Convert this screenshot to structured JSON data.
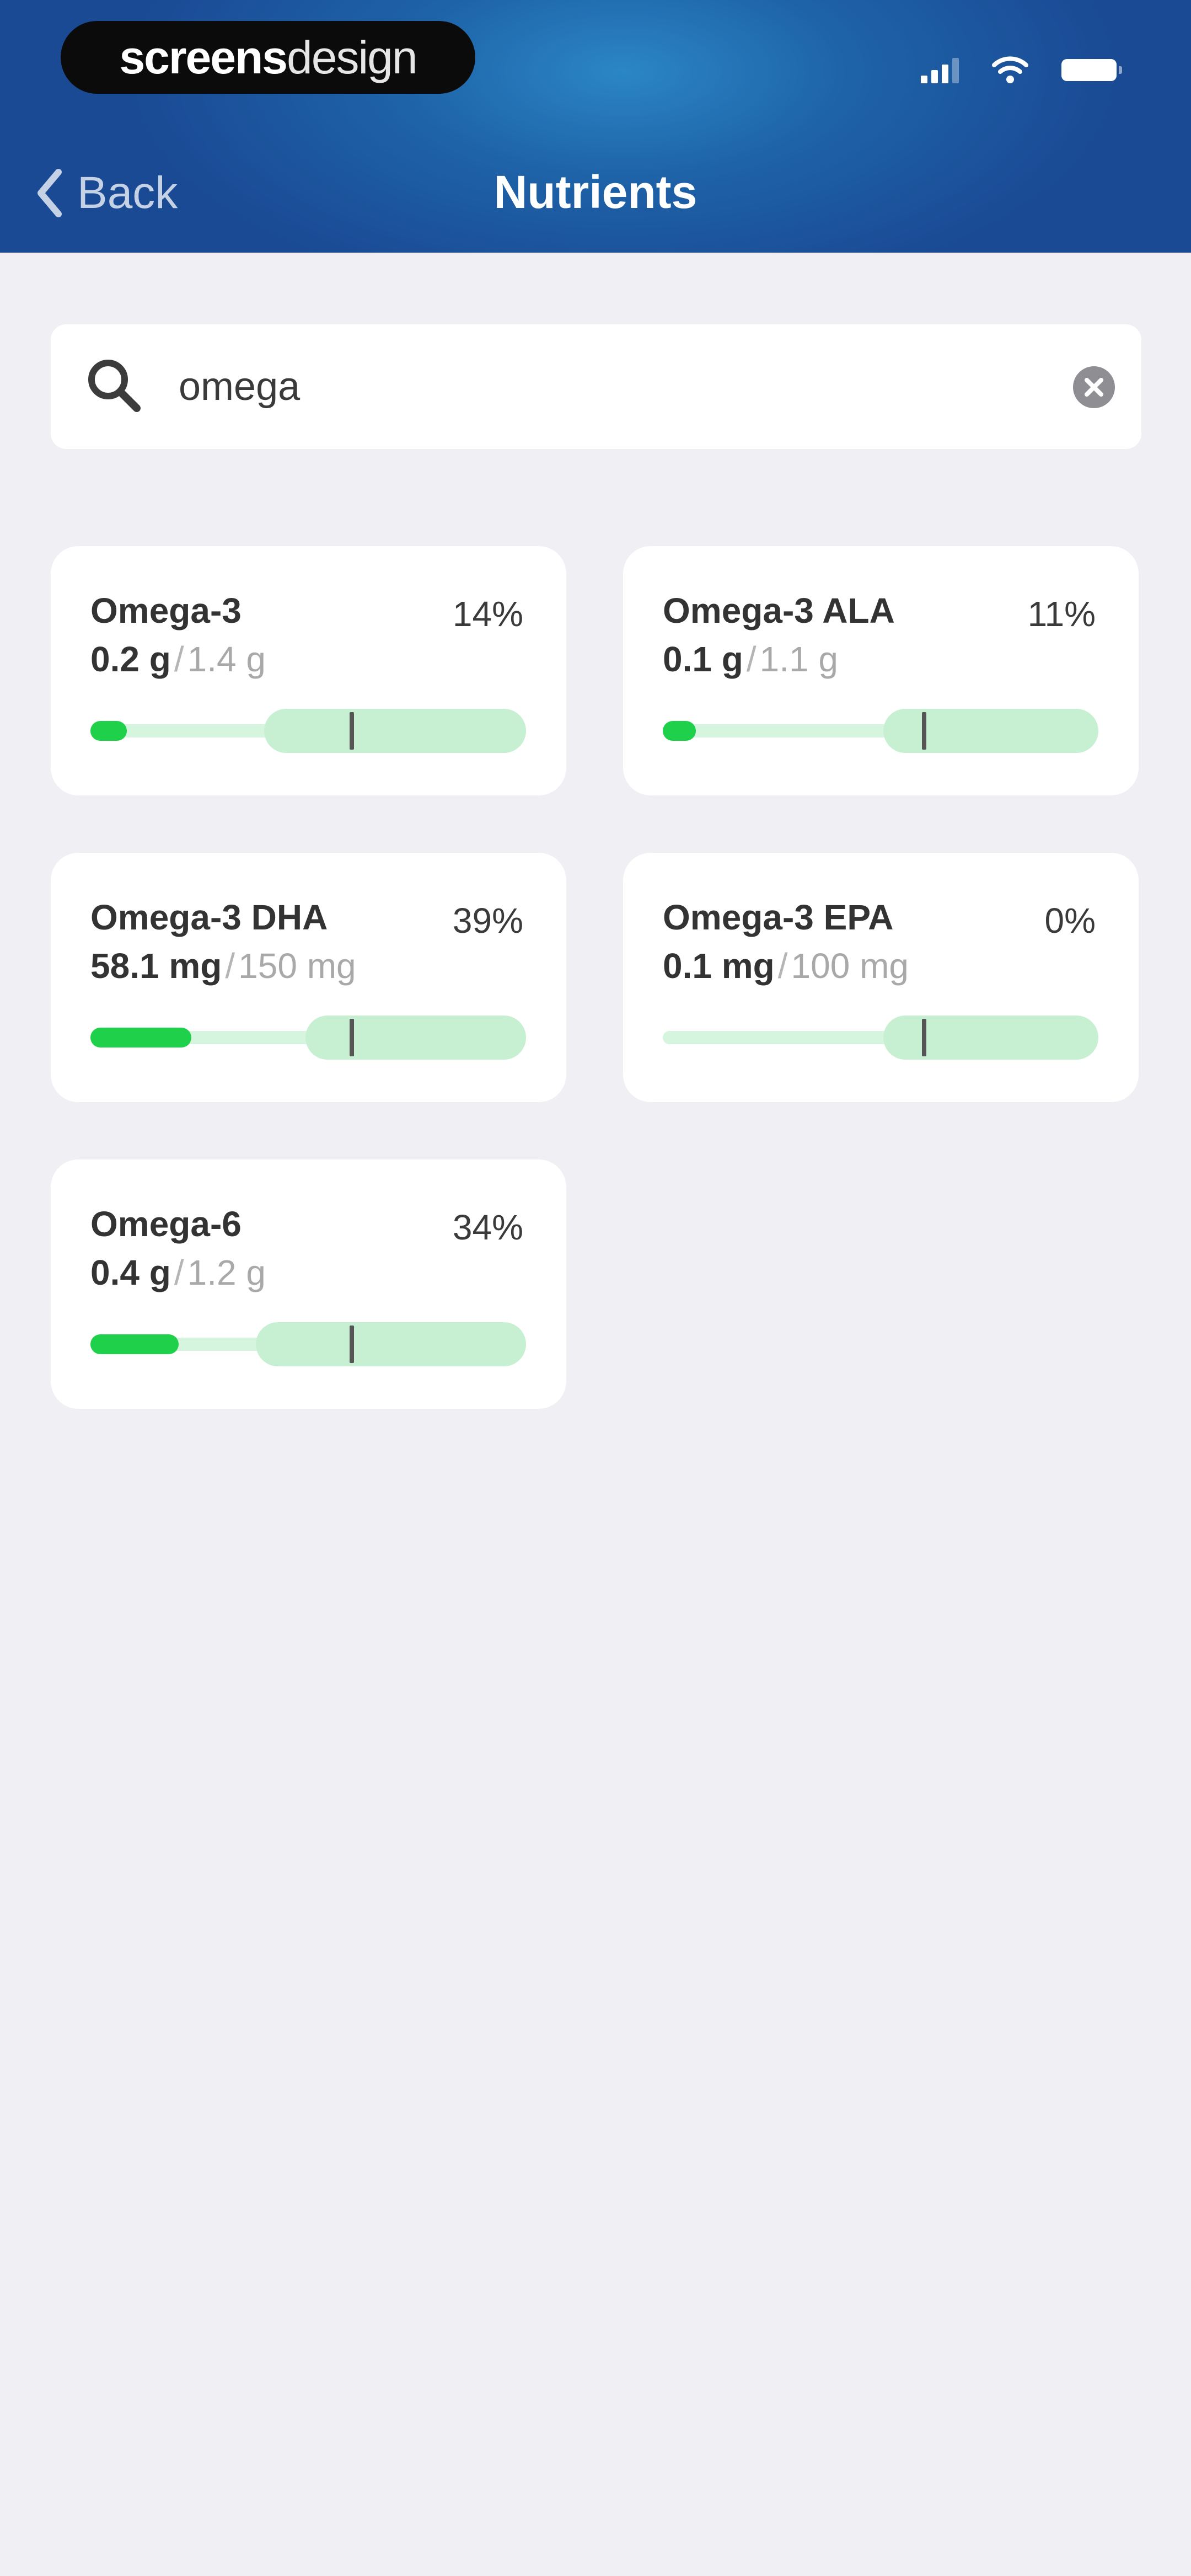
{
  "status_bar": {
    "brand": {
      "bold": "screens",
      "light": "design"
    }
  },
  "nav": {
    "back_label": "Back",
    "title": "Nutrients"
  },
  "search": {
    "value": "omega",
    "placeholder": ""
  },
  "nutrients": [
    {
      "name": "Omega-3",
      "amount": "0.2 g",
      "target": "1.4 g",
      "percent": "14%",
      "progress": 0.14
    },
    {
      "name": "Omega-3 ALA",
      "amount": "0.1 g",
      "target": "1.1 g",
      "percent": "11%",
      "progress": 0.11
    },
    {
      "name": "Omega-3 DHA",
      "amount": "58.1 mg",
      "target": "150 mg",
      "percent": "39%",
      "progress": 0.39
    },
    {
      "name": "Omega-3 EPA",
      "amount": "0.1 mg",
      "target": "100 mg",
      "percent": "0%",
      "progress": 0.0
    },
    {
      "name": "Omega-6",
      "amount": "0.4 g",
      "target": "1.2 g",
      "percent": "34%",
      "progress": 0.34
    }
  ],
  "colors": {
    "header": "#1e63a8",
    "background": "#efeff4",
    "progress_fill": "#1fd14a",
    "progress_range": "#c6f0d1"
  }
}
